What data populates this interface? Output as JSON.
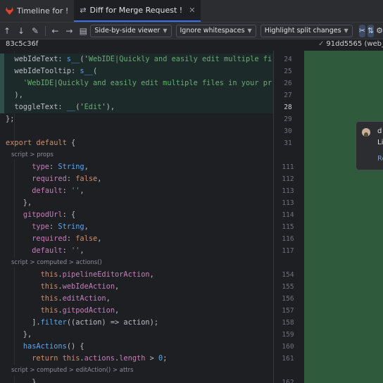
{
  "tabs": [
    {
      "label": "Timeline for !",
      "icon": "gitlab-fox-icon"
    },
    {
      "label": "Diff for Merge Request !",
      "icon": "diff-icon"
    }
  ],
  "toolbar": {
    "viewer": "Side-by-side viewer",
    "whitespace": "Ignore whitespaces",
    "highlight": "Highlight split changes"
  },
  "revisions": {
    "left": "83c5c36f",
    "right": "91dd5565 (web_"
  },
  "editor": {
    "lines": [
      [
        [
          "t",
          "  webIdeText: "
        ],
        [
          "f",
          "s__"
        ],
        [
          "t",
          "('"
        ],
        [
          "s",
          "WebIDE|Quickly and easily edit multiple fi"
        ]
      ],
      [
        [
          "t",
          "  webIdeTooltip: "
        ],
        [
          "f",
          "s__"
        ],
        [
          "t",
          "("
        ]
      ],
      [
        [
          "s",
          "    'WebIDE|Quickly and easily edit multiple files in your pr"
        ]
      ],
      [
        [
          "t",
          "  ),"
        ]
      ],
      [
        [
          "t",
          "  toggleText: "
        ],
        [
          "f",
          "__"
        ],
        [
          "t",
          "('"
        ],
        [
          "s",
          "Edit"
        ],
        [
          "t",
          "'),"
        ]
      ],
      [
        [
          "t",
          "};"
        ]
      ],
      [
        [
          "t",
          ""
        ]
      ],
      [
        [
          "k",
          "export default"
        ],
        [
          "t",
          " {"
        ]
      ],
      [
        [
          "t",
          ""
        ]
      ],
      [
        [
          "t",
          "      "
        ],
        [
          "p",
          "type"
        ],
        [
          "t",
          ": "
        ],
        [
          "f",
          "String"
        ],
        [
          "t",
          ","
        ]
      ],
      [
        [
          "t",
          "      "
        ],
        [
          "p",
          "required"
        ],
        [
          "t",
          ": "
        ],
        [
          "k",
          "false"
        ],
        [
          "t",
          ","
        ]
      ],
      [
        [
          "t",
          "      "
        ],
        [
          "p",
          "default"
        ],
        [
          "t",
          ": "
        ],
        [
          "s",
          "''"
        ],
        [
          "t",
          ","
        ]
      ],
      [
        [
          "t",
          "    },"
        ]
      ],
      [
        [
          "t",
          "    "
        ],
        [
          "p",
          "gitpodUrl"
        ],
        [
          "t",
          ": {"
        ]
      ],
      [
        [
          "t",
          "      "
        ],
        [
          "p",
          "type"
        ],
        [
          "t",
          ": "
        ],
        [
          "f",
          "String"
        ],
        [
          "t",
          ","
        ]
      ],
      [
        [
          "t",
          "      "
        ],
        [
          "p",
          "required"
        ],
        [
          "t",
          ": "
        ],
        [
          "k",
          "false"
        ],
        [
          "t",
          ","
        ]
      ],
      [
        [
          "t",
          "      "
        ],
        [
          "p",
          "default"
        ],
        [
          "t",
          ": "
        ],
        [
          "s",
          "''"
        ],
        [
          "t",
          ","
        ]
      ],
      [
        [
          "t",
          ""
        ]
      ],
      [
        [
          "t",
          "        "
        ],
        [
          "k",
          "this"
        ],
        [
          "t",
          "."
        ],
        [
          "p",
          "pipelineEditorAction"
        ],
        [
          "t",
          ","
        ]
      ],
      [
        [
          "t",
          "        "
        ],
        [
          "k",
          "this"
        ],
        [
          "t",
          "."
        ],
        [
          "p",
          "webIdeAction"
        ],
        [
          "t",
          ","
        ]
      ],
      [
        [
          "t",
          "        "
        ],
        [
          "k",
          "this"
        ],
        [
          "t",
          "."
        ],
        [
          "p",
          "editAction"
        ],
        [
          "t",
          ","
        ]
      ],
      [
        [
          "t",
          "        "
        ],
        [
          "k",
          "this"
        ],
        [
          "t",
          "."
        ],
        [
          "p",
          "gitpodAction"
        ],
        [
          "t",
          ","
        ]
      ],
      [
        [
          "t",
          "      ]."
        ],
        [
          "f",
          "filter"
        ],
        [
          "t",
          "(("
        ],
        [
          "t",
          "action"
        ],
        [
          "t",
          ") => action);"
        ]
      ],
      [
        [
          "t",
          "    },"
        ]
      ],
      [
        [
          "t",
          "    "
        ],
        [
          "f",
          "hasActions"
        ],
        [
          "t",
          "() {"
        ]
      ],
      [
        [
          "t",
          "      "
        ],
        [
          "k",
          "return this"
        ],
        [
          "t",
          "."
        ],
        [
          "p",
          "actions"
        ],
        [
          "t",
          "."
        ],
        [
          "p",
          "length"
        ],
        [
          "t",
          " > "
        ],
        [
          "f",
          "0"
        ],
        [
          "t",
          ";"
        ]
      ],
      [
        [
          "t",
          ""
        ]
      ],
      [
        [
          "t",
          "      },"
        ]
      ]
    ],
    "line_numbers": [
      "24",
      "25",
      "26",
      "27",
      "28",
      "29",
      "30",
      "31",
      "",
      "111",
      "112",
      "113",
      "113",
      "114",
      "115",
      "116",
      "117",
      "",
      "154",
      "155",
      "156",
      "157",
      "158",
      "159",
      "160",
      "161",
      "",
      "162"
    ]
  },
  "breadcrumbs": [
    "script > props",
    "script > computed > actions()",
    "script > computed > editAction() > attrs"
  ],
  "right_pane": {
    "line_numbers": [
      "",
      "",
      "",
      "",
      "",
      "",
      "",
      "",
      "",
      "",
      "",
      "",
      "",
      "",
      "",
      "",
      "",
      "",
      "",
      "",
      "",
      "",
      "",
      "",
      "",
      "",
      "",
      ""
    ],
    "code": [
      "",
      "",
      "",
      "",
      "",
      "",
      "",
      "",
      "",
      "",
      "",
      "",
      "",
      "",
      "",
      "",
      "",
      "",
      "",
      "",
      "",
      "",
      "",
      "",
      "",
      "",
      "",
      ""
    ]
  },
  "popup": {
    "name": "d",
    "text": "Li",
    "link": "Re"
  },
  "colors": {
    "accent": "#3574f0",
    "changed": "#2f5a3b",
    "background": "#1e1f22"
  }
}
